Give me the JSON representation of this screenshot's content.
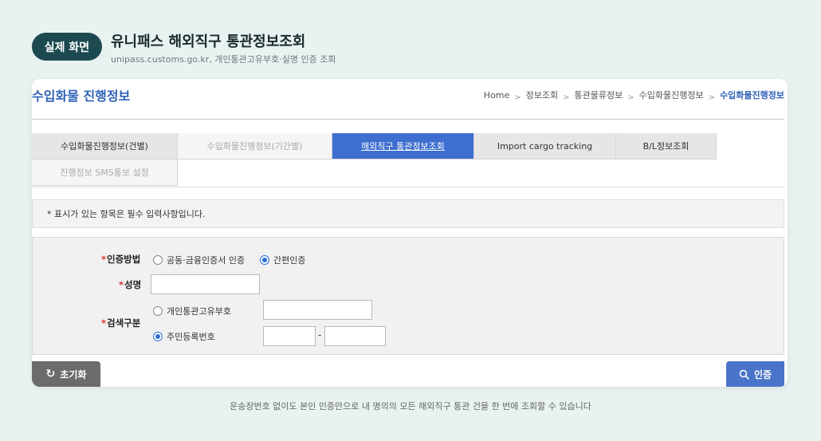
{
  "header": {
    "badge": "실제 화면",
    "title": "유니패스 해외직구 통관정보조회",
    "subtitle": "unipass.customs.go.kr, 개인통관고유부호·실명 인증 조회"
  },
  "page": {
    "title": "수입화물 진행정보",
    "breadcrumb": [
      "Home",
      "정보조회",
      "통관물류정보",
      "수입화물진행정보",
      "수입화물진행정보"
    ]
  },
  "tabs": [
    {
      "label": "수입화물진행정보(건별)",
      "state": "normal"
    },
    {
      "label": "수입화물진행정보(기간별)",
      "state": "dim"
    },
    {
      "label": "해외직구 통관정보조회",
      "state": "active"
    },
    {
      "label": "Import cargo tracking",
      "state": "normal"
    },
    {
      "label": "B/L정보조회",
      "state": "normal"
    },
    {
      "label": "진행정보 SMS통보 설정",
      "state": "dim"
    }
  ],
  "notice": "* 표시가 있는 항목은 필수 입력사항입니다.",
  "form": {
    "auth_label": "인증방법",
    "auth_options": [
      {
        "label": "공동·금융인증서 인증",
        "checked": false
      },
      {
        "label": "간편인증",
        "checked": true
      }
    ],
    "name_label": "성명",
    "name_value": "",
    "search_label": "검색구분",
    "search_options": [
      {
        "label": "개인통관고유부호",
        "checked": false
      },
      {
        "label": "주민등록번호",
        "checked": true
      }
    ],
    "pccc_value": "",
    "rrn_front_value": "",
    "rrn_dash": "-",
    "rrn_back_value": "",
    "required_mark": "*"
  },
  "buttons": {
    "reset_label": "초기화",
    "auth_label": "인증"
  },
  "caption": "운송장번호 없이도 본인 인증만으로 내 명의의 모든 해외직구 통관 건을 한 번에 조회할 수 있습니다",
  "colors": {
    "accent": "#3d6ed0",
    "badge": "#1d4a50",
    "required": "#dd3333"
  }
}
